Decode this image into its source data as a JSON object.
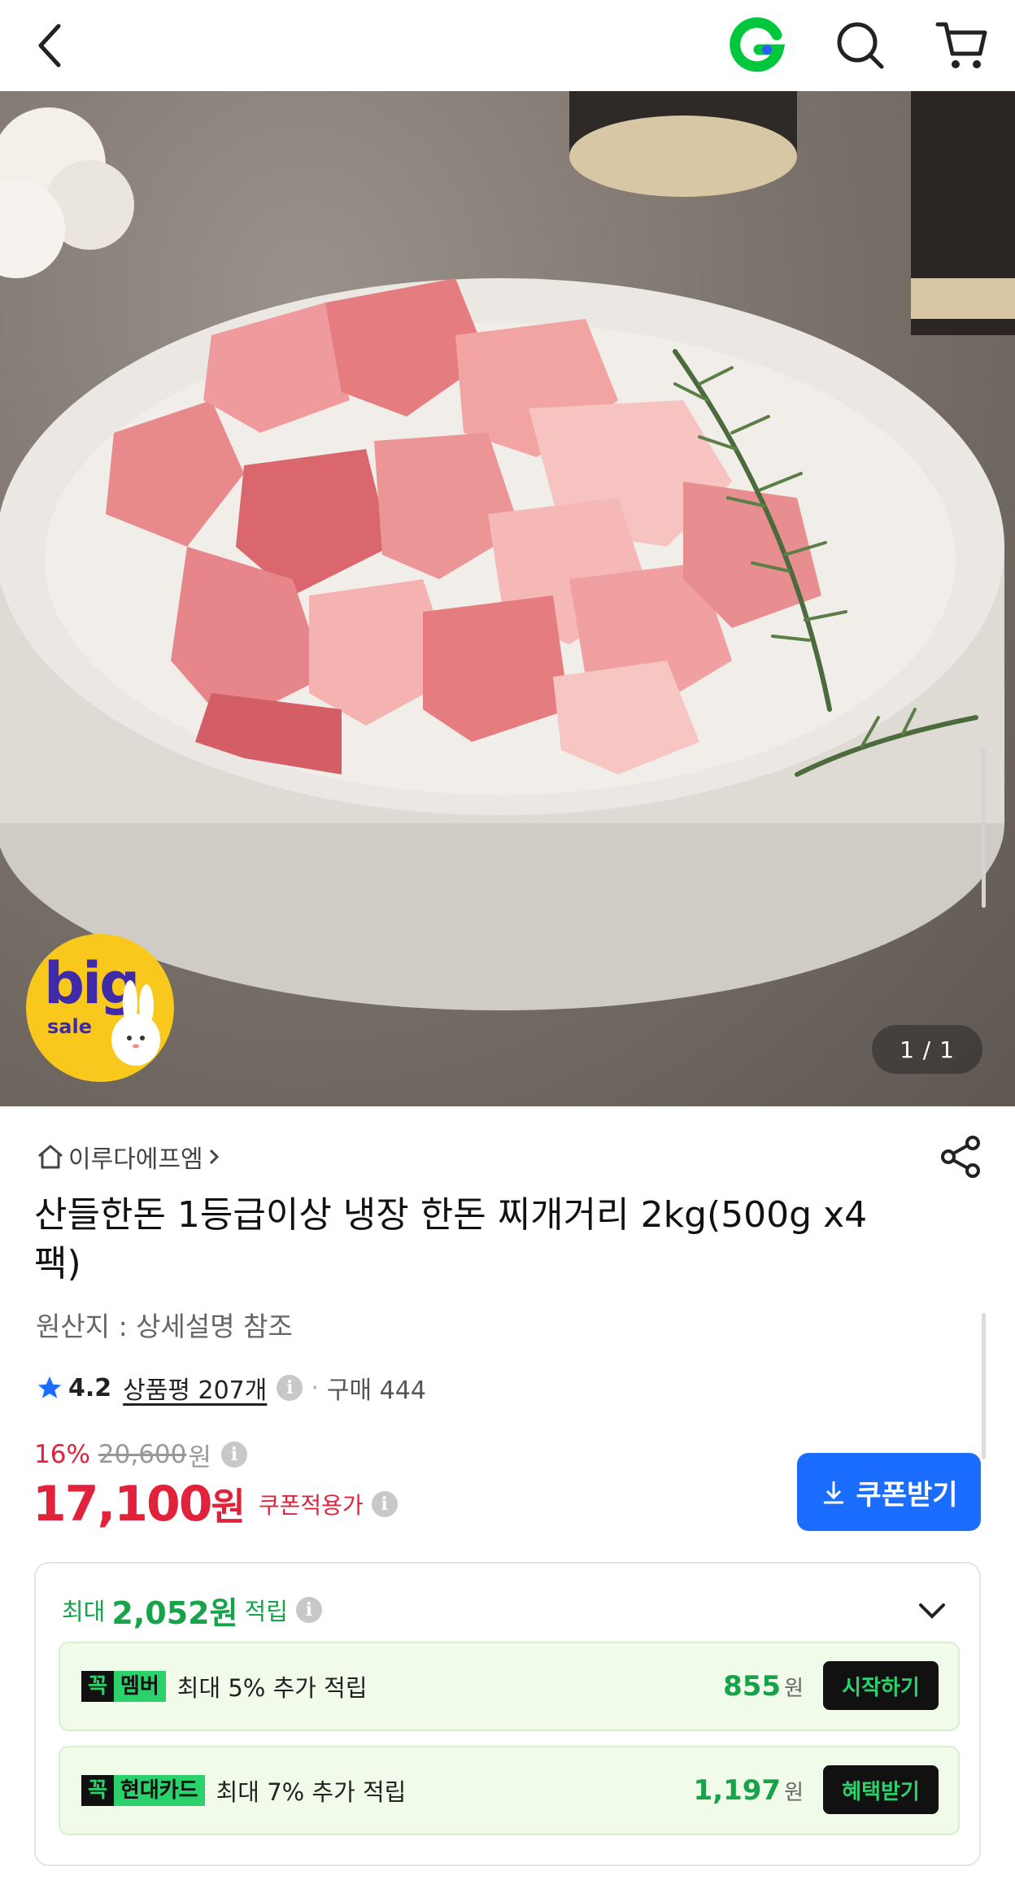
{
  "header": {
    "back_icon": "chevron-left-icon",
    "logo_icon": "gmarket-g-logo",
    "search_icon": "search-icon",
    "cart_icon": "cart-icon"
  },
  "hero": {
    "image_label": "product-photo-diced-pork-on-plate",
    "counter": "1 / 1",
    "badge_big": "big",
    "badge_sale": "sale"
  },
  "product": {
    "store_name": "이루다에프엠",
    "title": "산들한돈 1등급이상 냉장 한돈 찌개거리 2kg(500g x4팩)",
    "origin": "원산지 : 상세설명 참조",
    "rating": "4.2",
    "review_label": "상품평 207개",
    "purchases": "구매 444",
    "discount": "16%",
    "original_price": "20,600",
    "won": "원",
    "price": "17,100",
    "coupon_price_label": "쿠폰적용가",
    "coupon_button": "쿠폰받기"
  },
  "rewards": {
    "prefix": "최대",
    "amount": "2,052원",
    "suffix": "적립",
    "items": [
      {
        "tag_a": "꼭",
        "tag_b": "멤버",
        "desc": "최대 5% 추가 적립",
        "points": "855",
        "unit": "원",
        "button": "시작하기"
      },
      {
        "tag_a": "꼭",
        "tag_b": "현대카드",
        "desc": "최대 7% 추가 적립",
        "points": "1,197",
        "unit": "원",
        "button": "혜택받기"
      }
    ]
  },
  "colors": {
    "accent_red": "#e0223b",
    "coupon_blue": "#1a6dff",
    "reward_green": "#16a34a",
    "logo_green": "#00c73c"
  }
}
